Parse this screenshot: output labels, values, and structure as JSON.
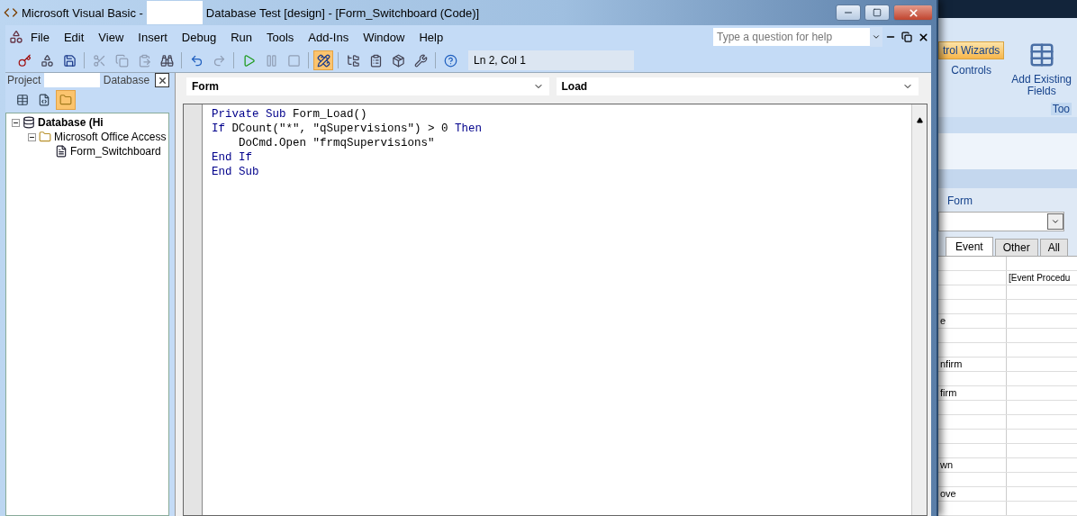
{
  "title_bar": {
    "title_start": "Microsoft Visual Basic - ",
    "title_end": "Database Test [design] - [Form_Switchboard (Code)]"
  },
  "menu": [
    "File",
    "Edit",
    "View",
    "Insert",
    "Debug",
    "Run",
    "Tools",
    "Add-Ins",
    "Window",
    "Help"
  ],
  "help_box": {
    "placeholder": "Type a question for help"
  },
  "toolbar": {
    "buttons": [
      {
        "kind": "access",
        "pressed": false,
        "disabled": false
      },
      {
        "kind": "insert",
        "pressed": false,
        "disabled": false
      },
      {
        "kind": "save",
        "pressed": false,
        "disabled": false
      },
      {
        "kind": "cut",
        "pressed": false,
        "disabled": true
      },
      {
        "kind": "copy",
        "pressed": false,
        "disabled": true
      },
      {
        "kind": "paste",
        "pressed": false,
        "disabled": true
      },
      {
        "kind": "find",
        "pressed": false,
        "disabled": false
      },
      {
        "kind": "undo",
        "pressed": false,
        "disabled": false
      },
      {
        "kind": "redo",
        "pressed": false,
        "disabled": true
      },
      {
        "kind": "run",
        "pressed": false,
        "disabled": false
      },
      {
        "kind": "break",
        "pressed": false,
        "disabled": true
      },
      {
        "kind": "reset",
        "pressed": false,
        "disabled": true
      },
      {
        "kind": "design",
        "pressed": true,
        "disabled": false
      },
      {
        "kind": "explorer",
        "pressed": false,
        "disabled": false
      },
      {
        "kind": "properties",
        "pressed": false,
        "disabled": false
      },
      {
        "kind": "browser",
        "pressed": false,
        "disabled": false
      },
      {
        "kind": "toolbox",
        "pressed": false,
        "disabled": false
      },
      {
        "kind": "help",
        "pressed": false,
        "disabled": false
      }
    ],
    "position": "Ln 2, Col 1"
  },
  "project_pane": {
    "title_start": "Project",
    "title_end": "Database",
    "buttons": [
      {
        "kind": "object",
        "pressed": false
      },
      {
        "kind": "code",
        "pressed": false
      },
      {
        "kind": "folders",
        "pressed": true
      }
    ],
    "tree": [
      {
        "label": "Database (Hi",
        "expanded": true,
        "children": [
          {
            "label": "Microsoft Office Access",
            "expanded": true,
            "children": [
              {
                "label": "Form_Switchboard"
              }
            ]
          }
        ]
      }
    ]
  },
  "code_window": {
    "object": "Form",
    "procedure": "Load",
    "lines": [
      [
        {
          "text": "Private Sub",
          "kind": "keyword"
        },
        {
          "text": " Form_Load()",
          "kind": "plain"
        }
      ],
      [
        {
          "text": "If",
          "kind": "keyword"
        },
        {
          "text": " DCount(\"*\", \"qSupervisions\") > 0 ",
          "kind": "plain"
        },
        {
          "text": "Then",
          "kind": "keyword"
        }
      ],
      [
        {
          "text": "    DoCmd.Open \"frmqSupervisions\"",
          "kind": "plain"
        }
      ],
      [
        {
          "text": "End If",
          "kind": "keyword"
        }
      ],
      [
        {
          "text": "End Sub",
          "kind": "keyword"
        }
      ]
    ]
  },
  "background_app": {
    "ribbon": {
      "wizards": "trol Wizards",
      "controls": "Controls",
      "add_fields_1": "Add Existing",
      "add_fields_2": "Fields",
      "group": "Too"
    },
    "property_sheet": {
      "selection": "Form",
      "tabs": [
        {
          "label": "Event",
          "selected": true
        },
        {
          "label": "Other",
          "selected": false
        },
        {
          "label": "All",
          "selected": false
        }
      ],
      "rows": [
        {},
        {
          "value": "[Event Procedu"
        },
        {},
        {},
        {
          "label": "e"
        },
        {},
        {},
        {
          "label": "nfirm"
        },
        {},
        {
          "label": "firm"
        },
        {},
        {},
        {},
        {},
        {
          "label": "wn"
        },
        {},
        {
          "label": "ove"
        },
        {}
      ]
    }
  }
}
